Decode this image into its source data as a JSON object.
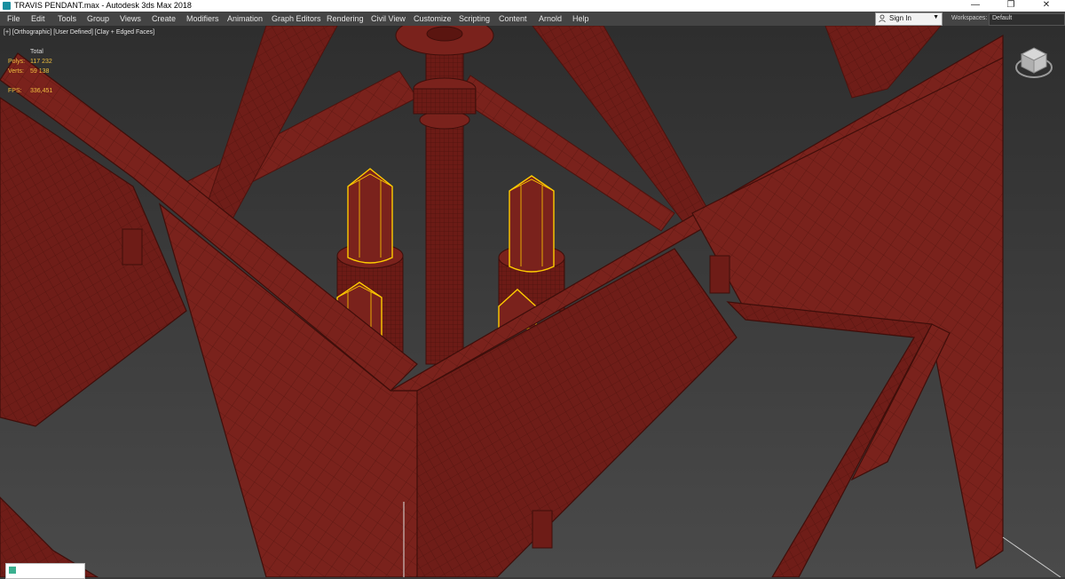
{
  "window": {
    "title": "TRAVIS PENDANT.max - Autodesk 3ds Max 2018",
    "controls": {
      "minimize": "—",
      "restore": "❐",
      "close": "✕"
    }
  },
  "menu": {
    "items": [
      "File",
      "Edit",
      "Tools",
      "Group",
      "Views",
      "Create",
      "Modifiers",
      "Animation",
      "Graph Editors",
      "Rendering",
      "Civil View",
      "Customize",
      "Scripting",
      "Content",
      "Arnold",
      "Help"
    ]
  },
  "account": {
    "sign_in_label": "Sign In",
    "icon": "user-icon"
  },
  "workspaces": {
    "label": "Workspaces:",
    "selected": "Default"
  },
  "viewport": {
    "label": "[+] [Orthographic] [User Defined] [Clay + Edged Faces]",
    "stats": {
      "header": "Total",
      "polys_label": "Polys:",
      "polys_value": "117 232",
      "verts_label": "Verts:",
      "verts_value": "59 138",
      "fps_label": "FPS:",
      "fps_value": "336,451"
    },
    "model_color": "#7a221c",
    "edge_color": "#4e120d",
    "selection_color": "#ffcc00",
    "background_color": "#3a3a3a",
    "viewcube_icon": "viewcube-icon"
  },
  "taskbar_chip": {
    "text": "",
    "icon": "app-icon"
  }
}
